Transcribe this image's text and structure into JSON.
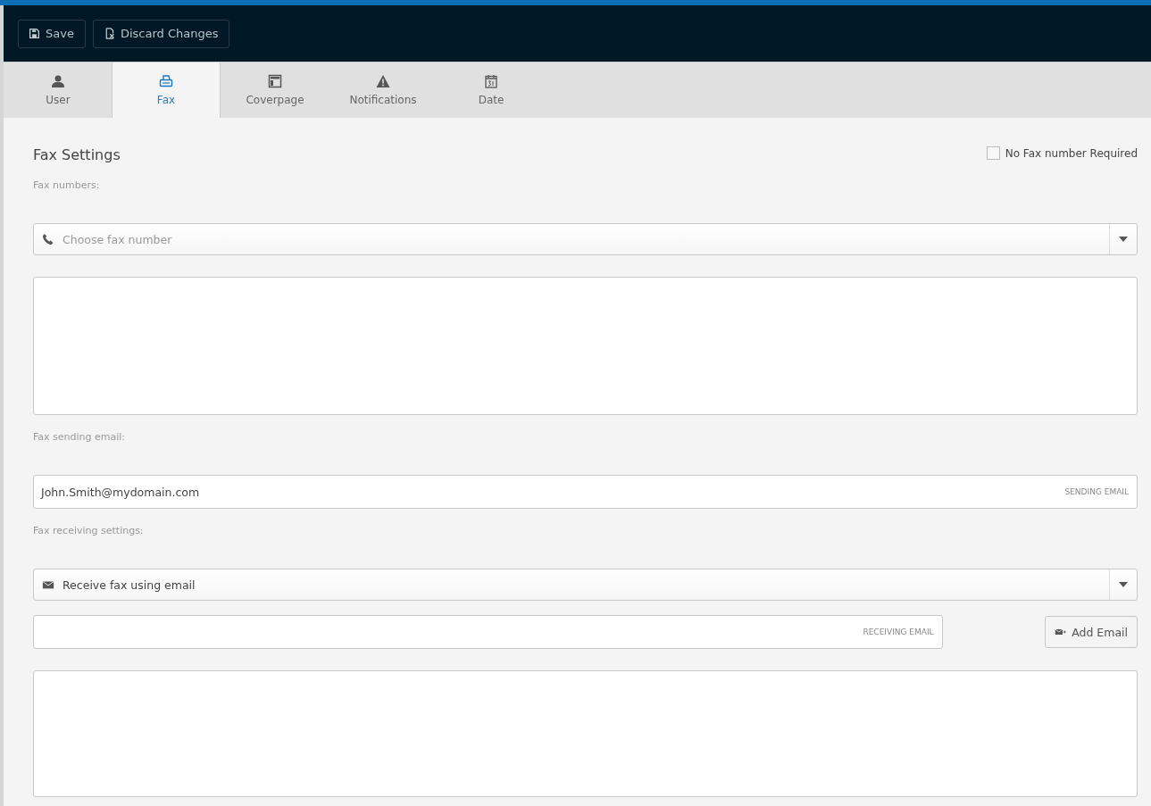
{
  "toolbar": {
    "buttons": [
      {
        "label": "Save"
      },
      {
        "label": "Discard Changes"
      }
    ]
  },
  "tabs": [
    {
      "label": "User",
      "selected": false
    },
    {
      "label": "Fax",
      "selected": true
    },
    {
      "label": "Coverpage",
      "selected": false
    },
    {
      "label": "Notifications",
      "selected": false
    },
    {
      "label": "Date",
      "selected": false
    }
  ],
  "section": {
    "title": "Fax Settings",
    "checkbox": {
      "label": "No Fax number Required",
      "checked": false
    }
  },
  "form": [
    {
      "kind": "label",
      "text": "Fax numbers:"
    },
    {
      "kind": "select",
      "placeholder": "Choose fax number"
    },
    {
      "kind": "list"
    },
    {
      "kind": "label",
      "text": "Fax sending email:"
    },
    {
      "kind": "input",
      "value": "John.Smith@mydomain.com",
      "tag": "SENDING EMAIL"
    },
    {
      "kind": "label",
      "text": "Fax receiving settings:"
    },
    {
      "kind": "select",
      "value": "Receive fax using email"
    },
    {
      "kind": "input_button",
      "tag": "RECEIVING EMAIL",
      "button": "Add Email"
    },
    {
      "kind": "list"
    }
  ]
}
